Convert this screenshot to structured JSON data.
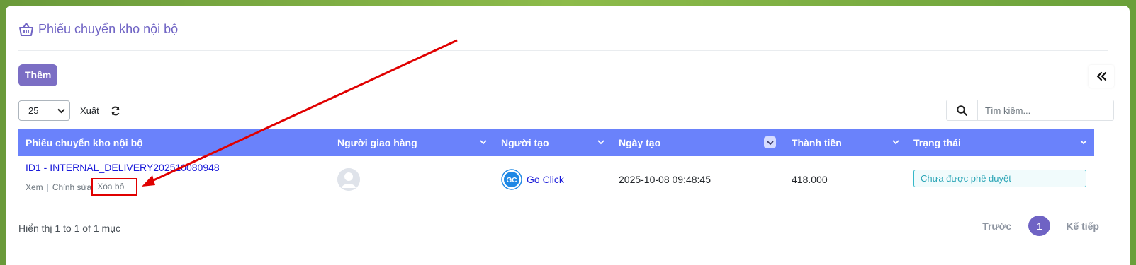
{
  "header": {
    "title": "Phiếu chuyển kho nội bộ",
    "icon": "basket-icon"
  },
  "toolbar": {
    "add_label": "Thêm",
    "page_size": "25",
    "export_label": "Xuất",
    "search_placeholder": "Tìm kiếm..."
  },
  "table": {
    "columns": [
      "Phiếu chuyển kho nội bộ",
      "Người giao hàng",
      "Người tạo",
      "Ngày tạo",
      "Thành tiền",
      "Trạng thái"
    ],
    "rows": [
      {
        "doc": "ID1 - INTERNAL_DELIVERY202510080948",
        "actions": {
          "view": "Xem",
          "edit": "Chỉnh sửa",
          "delete": "Xóa bỏ"
        },
        "creator": "Go Click",
        "created_at": "2025-10-08 09:48:45",
        "amount": "418.000",
        "status": "Chưa được phê duyệt"
      }
    ]
  },
  "footer": {
    "info": "Hiển thị 1 to 1 of 1 mục",
    "prev": "Trước",
    "page": "1",
    "next": "Kế tiếp"
  },
  "colors": {
    "accent": "#6f63c4",
    "table_header": "#6a82fb",
    "annotation": "#e00000",
    "link": "#1a1ad9"
  }
}
